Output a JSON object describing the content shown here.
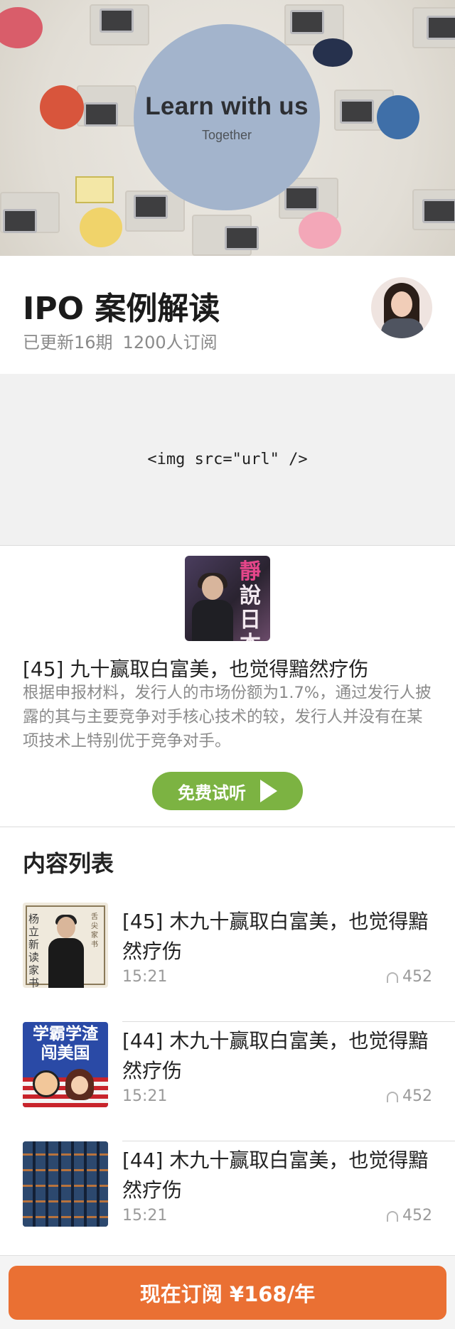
{
  "hero": {
    "title": "Learn with us",
    "subtitle": "Together"
  },
  "course": {
    "title": "IPO 案例解读",
    "updated": "已更新16期",
    "subscribers": "1200人订阅"
  },
  "placeholder": {
    "code": "<img src=\"url\" />"
  },
  "featured": {
    "cover_text": [
      "靜",
      "說",
      "日",
      "本"
    ],
    "title": "[45] 九十赢取白富美，也觉得黯然疗伤",
    "description": "根据申报材料，发行人的市场份额为1.7%，通过发行人披露的其与主要竞争对手核心技术的较，发行人并没有在某项技术上特别优于竞争对手。",
    "try_label": "免费试听"
  },
  "list": {
    "heading": "内容列表",
    "episodes": [
      {
        "title": "[45] 木九十赢取白富美，也觉得黯然疗伤",
        "time": "15:21",
        "plays": "452",
        "thumb_text": "杨立新读家书",
        "thumb_text2": "舌尖家书"
      },
      {
        "title": "[44] 木九十赢取白富美，也觉得黯然疗伤",
        "time": "15:21",
        "plays": "452",
        "thumb_text": "学霸学渣闯美国"
      },
      {
        "title": "[44] 木九十赢取白富美，也觉得黯然疗伤",
        "time": "15:21",
        "plays": "452"
      }
    ]
  },
  "subscribe": {
    "label": "现在订阅 ¥168/年"
  },
  "colors": {
    "accent_orange": "#ea7033",
    "try_green": "#7cb342",
    "hero_circle": "#a3b4cc"
  }
}
